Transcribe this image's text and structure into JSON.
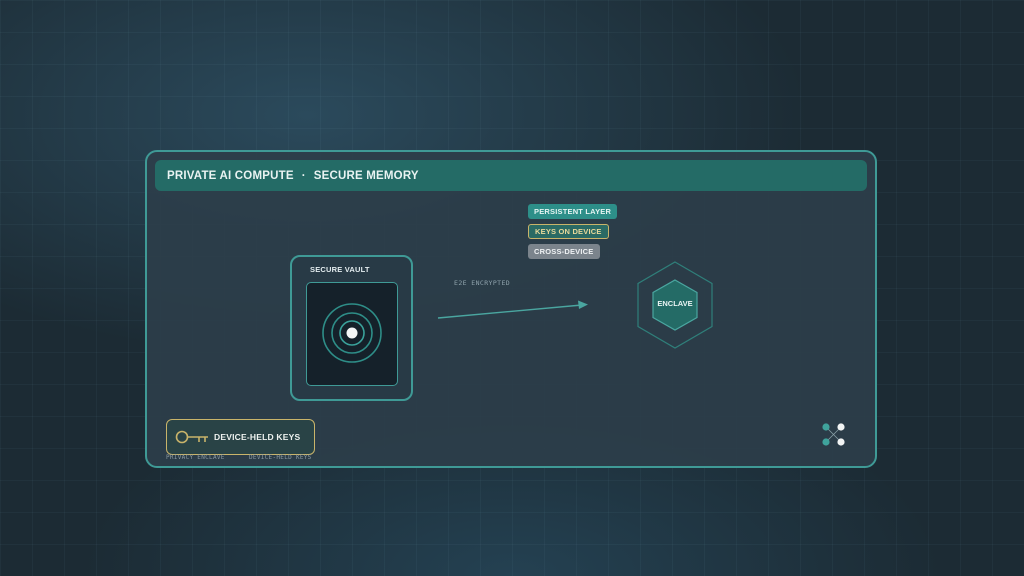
{
  "header": {
    "title_left": "PRIVATE AI COMPUTE",
    "separator": "·",
    "title_right": "SECURE MEMORY"
  },
  "badges": {
    "persistent": "PERSISTENT LAYER",
    "keys": "KEYS ON DEVICE",
    "cross": "CROSS-DEVICE"
  },
  "vault": {
    "label": "SECURE VAULT"
  },
  "arrow": {
    "label": "E2E ENCRYPTED"
  },
  "enclave": {
    "label": "ENCLAVE"
  },
  "keys_box": {
    "label": "DEVICE-HELD KEYS"
  },
  "footnotes": {
    "a": "PRIVACY ENCLAVE",
    "b": "DEVICE-HELD KEYS"
  },
  "icons": {
    "vault": "concentric-rings-icon",
    "key": "key-icon",
    "logo": "four-dot-logo-icon",
    "enclave": "hexagon-icon"
  },
  "colors": {
    "accent_teal": "#3f9a96",
    "header_bg": "#246b66",
    "gold": "#c9b46a",
    "panel_bg": "#2c3e4a"
  }
}
